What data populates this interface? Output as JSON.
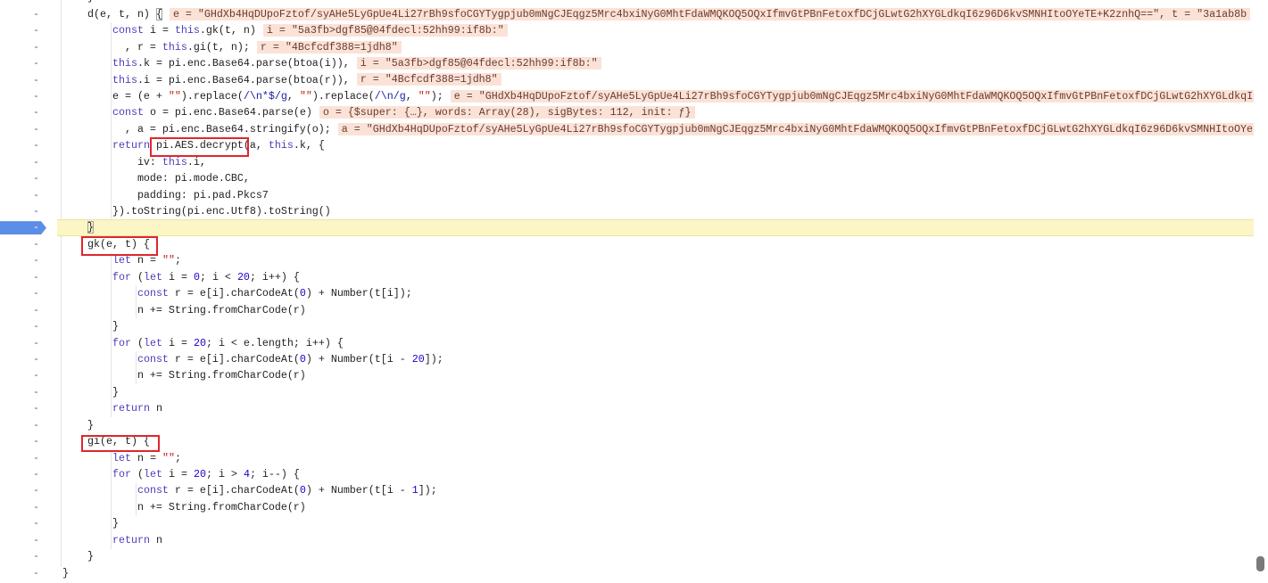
{
  "colors": {
    "keyword": "#4b3fb8",
    "string": "#c41a16",
    "number": "#1c00cf",
    "regex": "#1a1aa6",
    "inline-bg": "#fbe2d6",
    "paused-bg": "#fcf6c6",
    "exec": "#5b8ee6",
    "annotation": "#e0262e"
  },
  "editor": {
    "lines": [
      {
        "marker": "-",
        "code": [
          [
            "p",
            "    }"
          ]
        ]
      },
      {
        "marker": "-",
        "code": [
          [
            "p",
            "    d(e, t, n) "
          ],
          [
            "b",
            "{"
          ]
        ],
        "inline": "e = \"GHdXb4HqDUpoFztof/syAHe5LyGpUe4Li27rBh9sfoCGYTygpjub0mNgCJEqgz5Mrc4bxiNyG0MhtFdaWMQKOQ5OQxIfmvGtPBnFetoxfDCjGLwtG2hXYGLdkqI6z96D6kvSMNHItoOYeTE+K2znhQ==\", t = \"3a1ab8b"
      },
      {
        "marker": "-",
        "code": [
          [
            "p",
            "        "
          ],
          [
            "k",
            "const"
          ],
          [
            "p",
            " i = "
          ],
          [
            "k",
            "this"
          ],
          [
            "p",
            ".gk(t, n)"
          ]
        ],
        "inline": "i = \"5a3fb>dgf85@04fdecl:52hh99:if8b:\""
      },
      {
        "marker": "-",
        "code": [
          [
            "p",
            "          , r = "
          ],
          [
            "k",
            "this"
          ],
          [
            "p",
            ".gi(t, n);"
          ]
        ],
        "inline": "r = \"4Bcfcdf388=1jdh8\""
      },
      {
        "marker": "-",
        "code": [
          [
            "p",
            "        "
          ],
          [
            "k",
            "this"
          ],
          [
            "p",
            ".k = pi.enc.Base64.parse(btoa(i)),"
          ]
        ],
        "inline": "i = \"5a3fb>dgf85@04fdecl:52hh99:if8b:\""
      },
      {
        "marker": "-",
        "code": [
          [
            "p",
            "        "
          ],
          [
            "k",
            "this"
          ],
          [
            "p",
            ".i = pi.enc.Base64.parse(btoa(r)),"
          ]
        ],
        "inline": "r = \"4Bcfcdf388=1jdh8\""
      },
      {
        "marker": "-",
        "code": [
          [
            "p",
            "        e = (e + "
          ],
          [
            "s",
            "\"\""
          ],
          [
            "p",
            ").replace("
          ],
          [
            "r",
            "/\\n*$/g"
          ],
          [
            "p",
            ", "
          ],
          [
            "s",
            "\"\""
          ],
          [
            "p",
            ").replace("
          ],
          [
            "r",
            "/\\n/g"
          ],
          [
            "p",
            ", "
          ],
          [
            "s",
            "\"\""
          ],
          [
            "p",
            ");"
          ]
        ],
        "inline": "e = \"GHdXb4HqDUpoFztof/syAHe5LyGpUe4Li27rBh9sfoCGYTygpjub0mNgCJEqgz5Mrc4bxiNyG0MhtFdaWMQKOQ5OQxIfmvGtPBnFetoxfDCjGLwtG2hXYGLdkqI"
      },
      {
        "marker": "-",
        "code": [
          [
            "p",
            "        "
          ],
          [
            "k",
            "const"
          ],
          [
            "p",
            " o = pi.enc.Base64.parse(e)"
          ]
        ],
        "inline": "o = {$super: {…}, words: Array(28), sigBytes: 112, init: ƒ}"
      },
      {
        "marker": "-",
        "code": [
          [
            "p",
            "          , a = pi.enc.Base64.stringify(o);"
          ]
        ],
        "inline": "a = \"GHdXb4HqDUpoFztof/syAHe5LyGpUe4Li27rBh9sfoCGYTygpjub0mNgCJEqgz5Mrc4bxiNyG0MhtFdaWMQKOQ5OQxIfmvGtPBnFetoxfDCjGLwtG2hXYGLdkqI6z96D6kvSMNHItoOYe"
      },
      {
        "marker": "-",
        "code": [
          [
            "p",
            "        "
          ],
          [
            "k",
            "return"
          ],
          [
            "p",
            " pi.AES.decrypt(a, "
          ],
          [
            "k",
            "this"
          ],
          [
            "p",
            ".k, {"
          ]
        ]
      },
      {
        "marker": "-",
        "code": [
          [
            "p",
            "            iv: "
          ],
          [
            "k",
            "this"
          ],
          [
            "p",
            ".i,"
          ]
        ]
      },
      {
        "marker": "-",
        "code": [
          [
            "p",
            "            mode: pi.mode.CBC,"
          ]
        ]
      },
      {
        "marker": "-",
        "code": [
          [
            "p",
            "            padding: pi.pad.Pkcs7"
          ]
        ]
      },
      {
        "marker": "-",
        "code": [
          [
            "p",
            "        }).toString(pi.enc.Utf8).toString()"
          ]
        ]
      },
      {
        "marker": "-",
        "paused": true,
        "code": [
          [
            "p",
            "    "
          ],
          [
            "b",
            "}"
          ]
        ]
      },
      {
        "marker": "-",
        "code": [
          [
            "p",
            "    gk(e, t) {"
          ]
        ]
      },
      {
        "marker": "-",
        "code": [
          [
            "p",
            "        "
          ],
          [
            "k",
            "let"
          ],
          [
            "p",
            " n = "
          ],
          [
            "s",
            "\"\""
          ],
          [
            "p",
            ";"
          ]
        ]
      },
      {
        "marker": "-",
        "code": [
          [
            "p",
            "        "
          ],
          [
            "k",
            "for"
          ],
          [
            "p",
            " ("
          ],
          [
            "k",
            "let"
          ],
          [
            "p",
            " i = "
          ],
          [
            "n",
            "0"
          ],
          [
            "p",
            "; i < "
          ],
          [
            "n",
            "20"
          ],
          [
            "p",
            "; i++) {"
          ]
        ]
      },
      {
        "marker": "-",
        "code": [
          [
            "p",
            "            "
          ],
          [
            "k",
            "const"
          ],
          [
            "p",
            " r = e[i].charCodeAt("
          ],
          [
            "n",
            "0"
          ],
          [
            "p",
            ") + Number(t[i]);"
          ]
        ]
      },
      {
        "marker": "-",
        "code": [
          [
            "p",
            "            n += String.fromCharCode(r)"
          ]
        ]
      },
      {
        "marker": "-",
        "code": [
          [
            "p",
            "        }"
          ]
        ]
      },
      {
        "marker": "-",
        "code": [
          [
            "p",
            "        "
          ],
          [
            "k",
            "for"
          ],
          [
            "p",
            " ("
          ],
          [
            "k",
            "let"
          ],
          [
            "p",
            " i = "
          ],
          [
            "n",
            "20"
          ],
          [
            "p",
            "; i < e.length; i++) {"
          ]
        ]
      },
      {
        "marker": "-",
        "code": [
          [
            "p",
            "            "
          ],
          [
            "k",
            "const"
          ],
          [
            "p",
            " r = e[i].charCodeAt("
          ],
          [
            "n",
            "0"
          ],
          [
            "p",
            ") + Number(t[i - "
          ],
          [
            "n",
            "20"
          ],
          [
            "p",
            "]);"
          ]
        ]
      },
      {
        "marker": "-",
        "code": [
          [
            "p",
            "            n += String.fromCharCode(r)"
          ]
        ]
      },
      {
        "marker": "-",
        "code": [
          [
            "p",
            "        }"
          ]
        ]
      },
      {
        "marker": "-",
        "code": [
          [
            "p",
            "        "
          ],
          [
            "k",
            "return"
          ],
          [
            "p",
            " n"
          ]
        ]
      },
      {
        "marker": "-",
        "code": [
          [
            "p",
            "    }"
          ]
        ]
      },
      {
        "marker": "-",
        "code": [
          [
            "p",
            "    gi(e, t) {"
          ]
        ]
      },
      {
        "marker": "-",
        "code": [
          [
            "p",
            "        "
          ],
          [
            "k",
            "let"
          ],
          [
            "p",
            " n = "
          ],
          [
            "s",
            "\"\""
          ],
          [
            "p",
            ";"
          ]
        ]
      },
      {
        "marker": "-",
        "code": [
          [
            "p",
            "        "
          ],
          [
            "k",
            "for"
          ],
          [
            "p",
            " ("
          ],
          [
            "k",
            "let"
          ],
          [
            "p",
            " i = "
          ],
          [
            "n",
            "20"
          ],
          [
            "p",
            "; i > "
          ],
          [
            "n",
            "4"
          ],
          [
            "p",
            "; i--) {"
          ]
        ]
      },
      {
        "marker": "-",
        "code": [
          [
            "p",
            "            "
          ],
          [
            "k",
            "const"
          ],
          [
            "p",
            " r = e[i].charCodeAt("
          ],
          [
            "n",
            "0"
          ],
          [
            "p",
            ") + Number(t[i - "
          ],
          [
            "n",
            "1"
          ],
          [
            "p",
            "]);"
          ]
        ]
      },
      {
        "marker": "-",
        "code": [
          [
            "p",
            "            n += String.fromCharCode(r)"
          ]
        ]
      },
      {
        "marker": "-",
        "code": [
          [
            "p",
            "        }"
          ]
        ]
      },
      {
        "marker": "-",
        "code": [
          [
            "p",
            "        "
          ],
          [
            "k",
            "return"
          ],
          [
            "p",
            " n"
          ]
        ]
      },
      {
        "marker": "-",
        "code": [
          [
            "p",
            "    }"
          ]
        ]
      },
      {
        "marker": "-",
        "code": [
          [
            "p",
            "}"
          ]
        ]
      }
    ]
  }
}
